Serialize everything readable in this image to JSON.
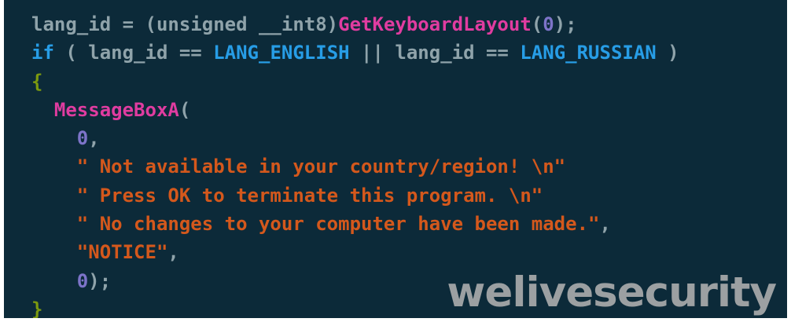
{
  "code_view": {
    "lines": [
      [
        {
          "t": "lang_id = (unsigned __int8)",
          "c": "ident"
        },
        {
          "t": "GetKeyboardLayout",
          "c": "fn"
        },
        {
          "t": "(",
          "c": "op"
        },
        {
          "t": "0",
          "c": "num"
        },
        {
          "t": ");",
          "c": "op"
        }
      ],
      [
        {
          "t": "if",
          "c": "kw"
        },
        {
          "t": " ( lang_id == ",
          "c": "ident"
        },
        {
          "t": "LANG_ENGLISH",
          "c": "const"
        },
        {
          "t": " || lang_id == ",
          "c": "ident"
        },
        {
          "t": "LANG_RUSSIAN",
          "c": "const"
        },
        {
          "t": " )",
          "c": "ident"
        }
      ],
      [
        {
          "t": "{",
          "c": "brace"
        }
      ],
      [
        {
          "t": "  ",
          "c": "ident"
        },
        {
          "t": "MessageBoxA",
          "c": "fn"
        },
        {
          "t": "(",
          "c": "op"
        }
      ],
      [
        {
          "t": "    ",
          "c": "ident"
        },
        {
          "t": "0",
          "c": "num"
        },
        {
          "t": ",",
          "c": "op"
        }
      ],
      [
        {
          "t": "    ",
          "c": "ident"
        },
        {
          "t": "\" Not available in your country/region! \\n\"",
          "c": "str"
        }
      ],
      [
        {
          "t": "    ",
          "c": "ident"
        },
        {
          "t": "\" Press OK to terminate this program. \\n\"",
          "c": "str"
        }
      ],
      [
        {
          "t": "    ",
          "c": "ident"
        },
        {
          "t": "\" No changes to your computer have been made.\"",
          "c": "str"
        },
        {
          "t": ",",
          "c": "op"
        }
      ],
      [
        {
          "t": "    ",
          "c": "ident"
        },
        {
          "t": "\"NOTICE\"",
          "c": "str"
        },
        {
          "t": ",",
          "c": "op"
        }
      ],
      [
        {
          "t": "    ",
          "c": "ident"
        },
        {
          "t": "0",
          "c": "num"
        },
        {
          "t": ");",
          "c": "op"
        }
      ],
      [
        {
          "t": "}",
          "c": "brace"
        }
      ]
    ]
  },
  "watermark": {
    "text": "welivesecurity"
  },
  "colors": {
    "background": "#0c2a39",
    "identifier": "#8fa3aa",
    "keyword": "#279de6",
    "function": "#e03ca0",
    "number": "#7d74c9",
    "string": "#d4581c",
    "brace": "#7c9a0f",
    "watermark": "#a9aaab"
  }
}
